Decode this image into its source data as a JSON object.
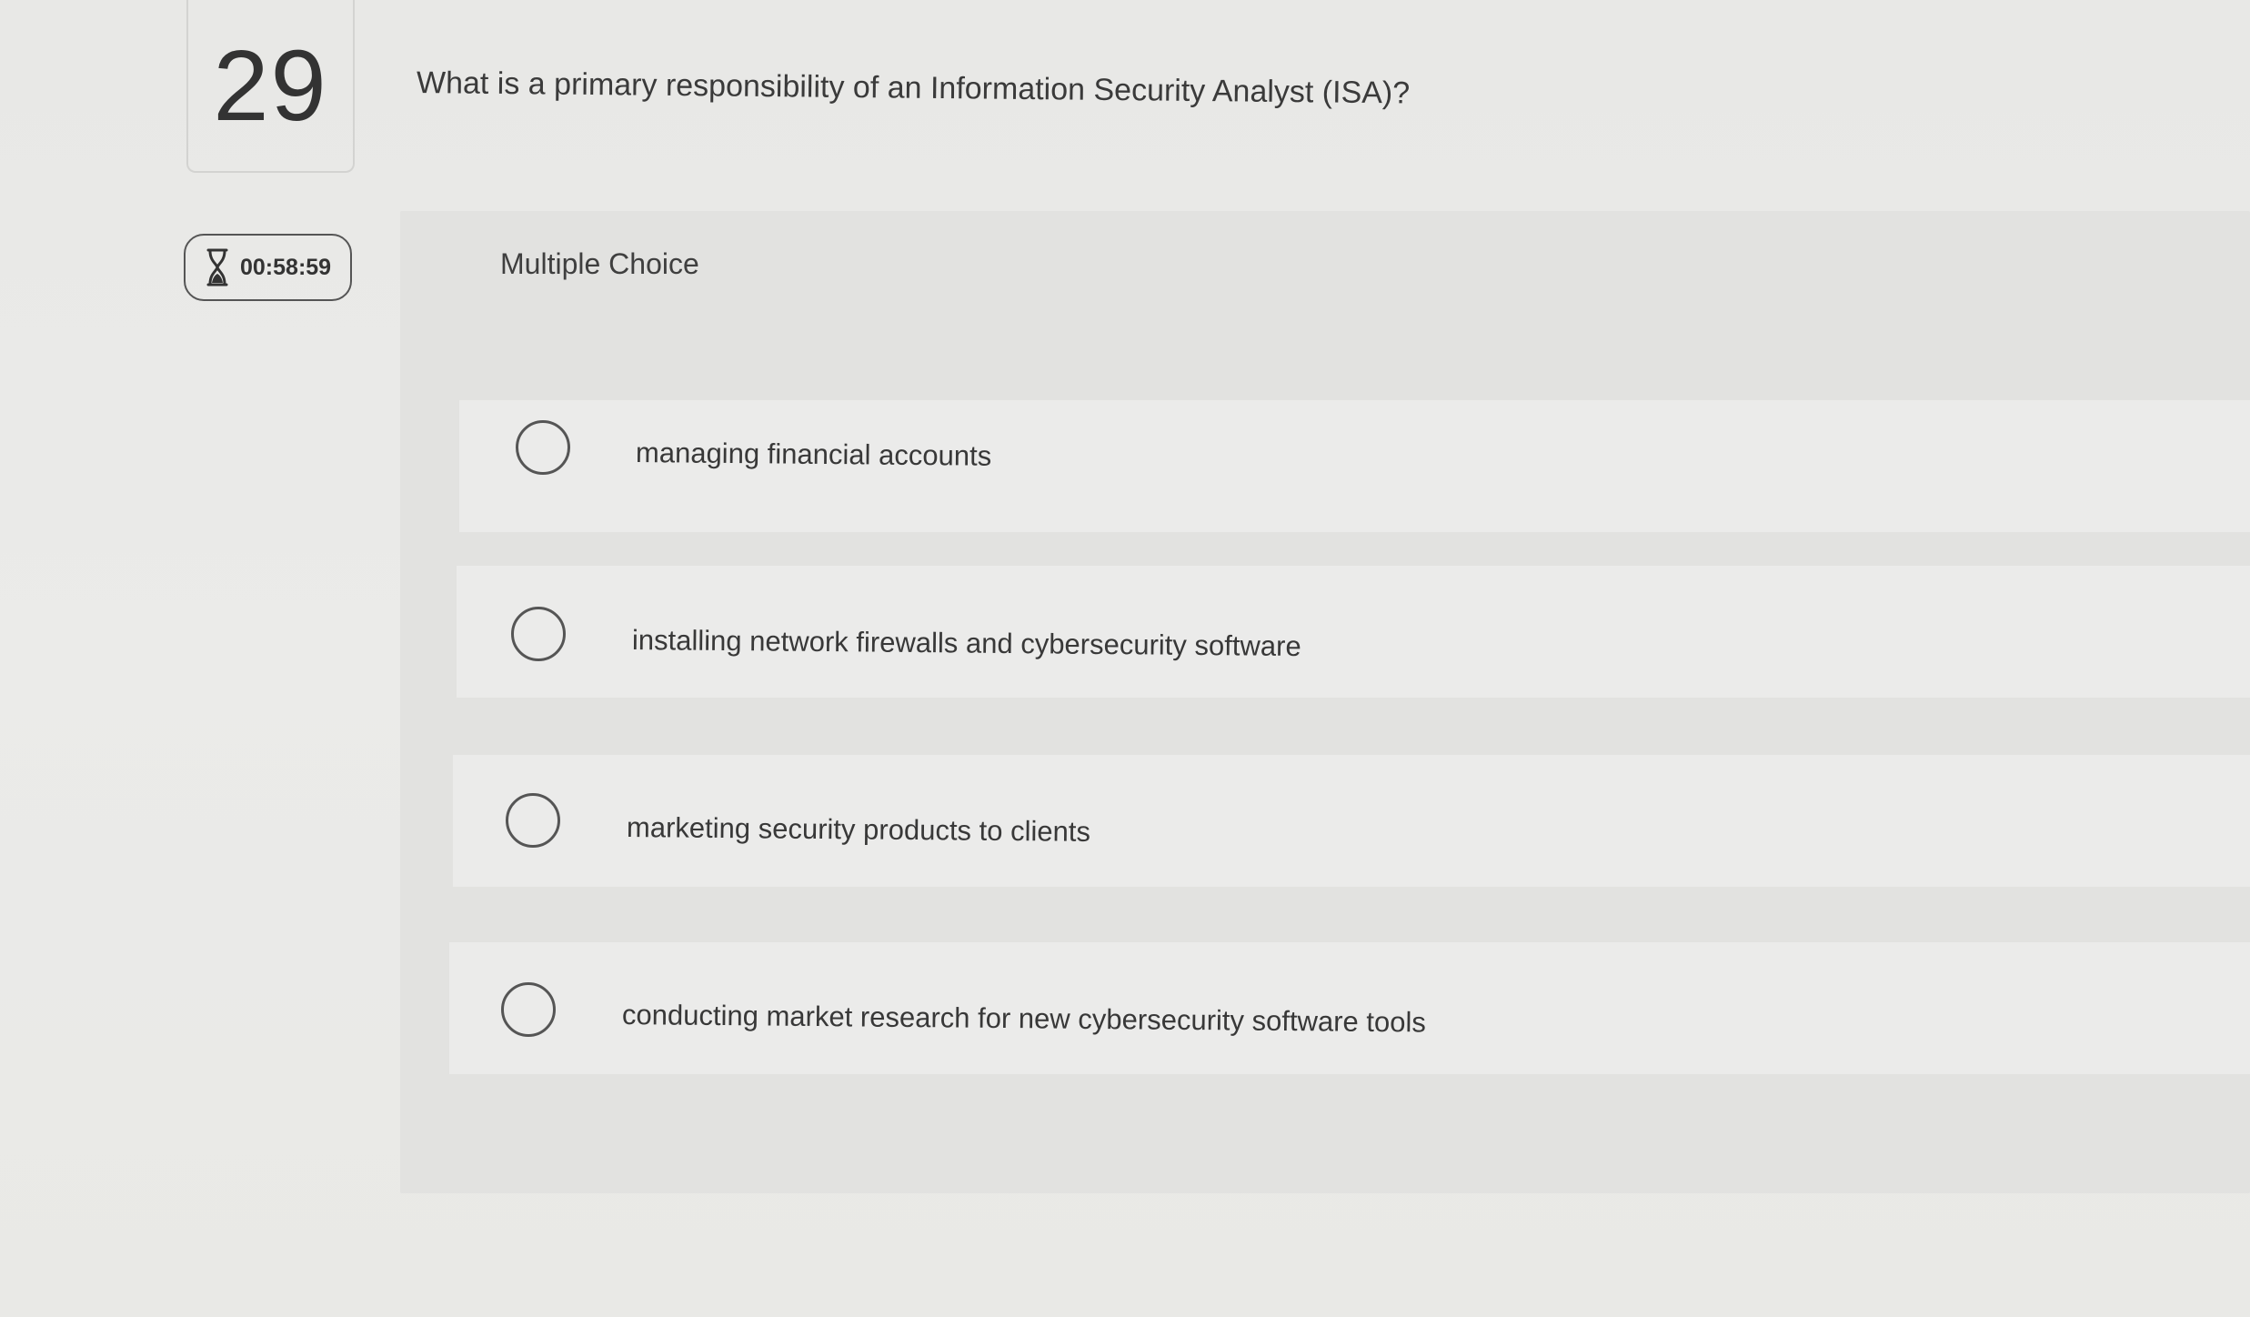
{
  "question": {
    "number": "29",
    "text": "What is a primary responsibility of an Information Security Analyst (ISA)?"
  },
  "timer": {
    "icon": "hourglass-icon",
    "value": "00:58:59"
  },
  "answer_panel": {
    "type_label": "Multiple Choice",
    "options": [
      {
        "label": "managing financial accounts",
        "selected": false
      },
      {
        "label": "installing network firewalls and cybersecurity software",
        "selected": false
      },
      {
        "label": "marketing security products to clients",
        "selected": false
      },
      {
        "label": "conducting market research for new cybersecurity software tools",
        "selected": false
      }
    ]
  },
  "colors": {
    "background": "#e9e9e7",
    "panel": "#e2e2e0",
    "option_row": "#ebebea",
    "text": "#3a3a3a",
    "border": "#555555"
  }
}
